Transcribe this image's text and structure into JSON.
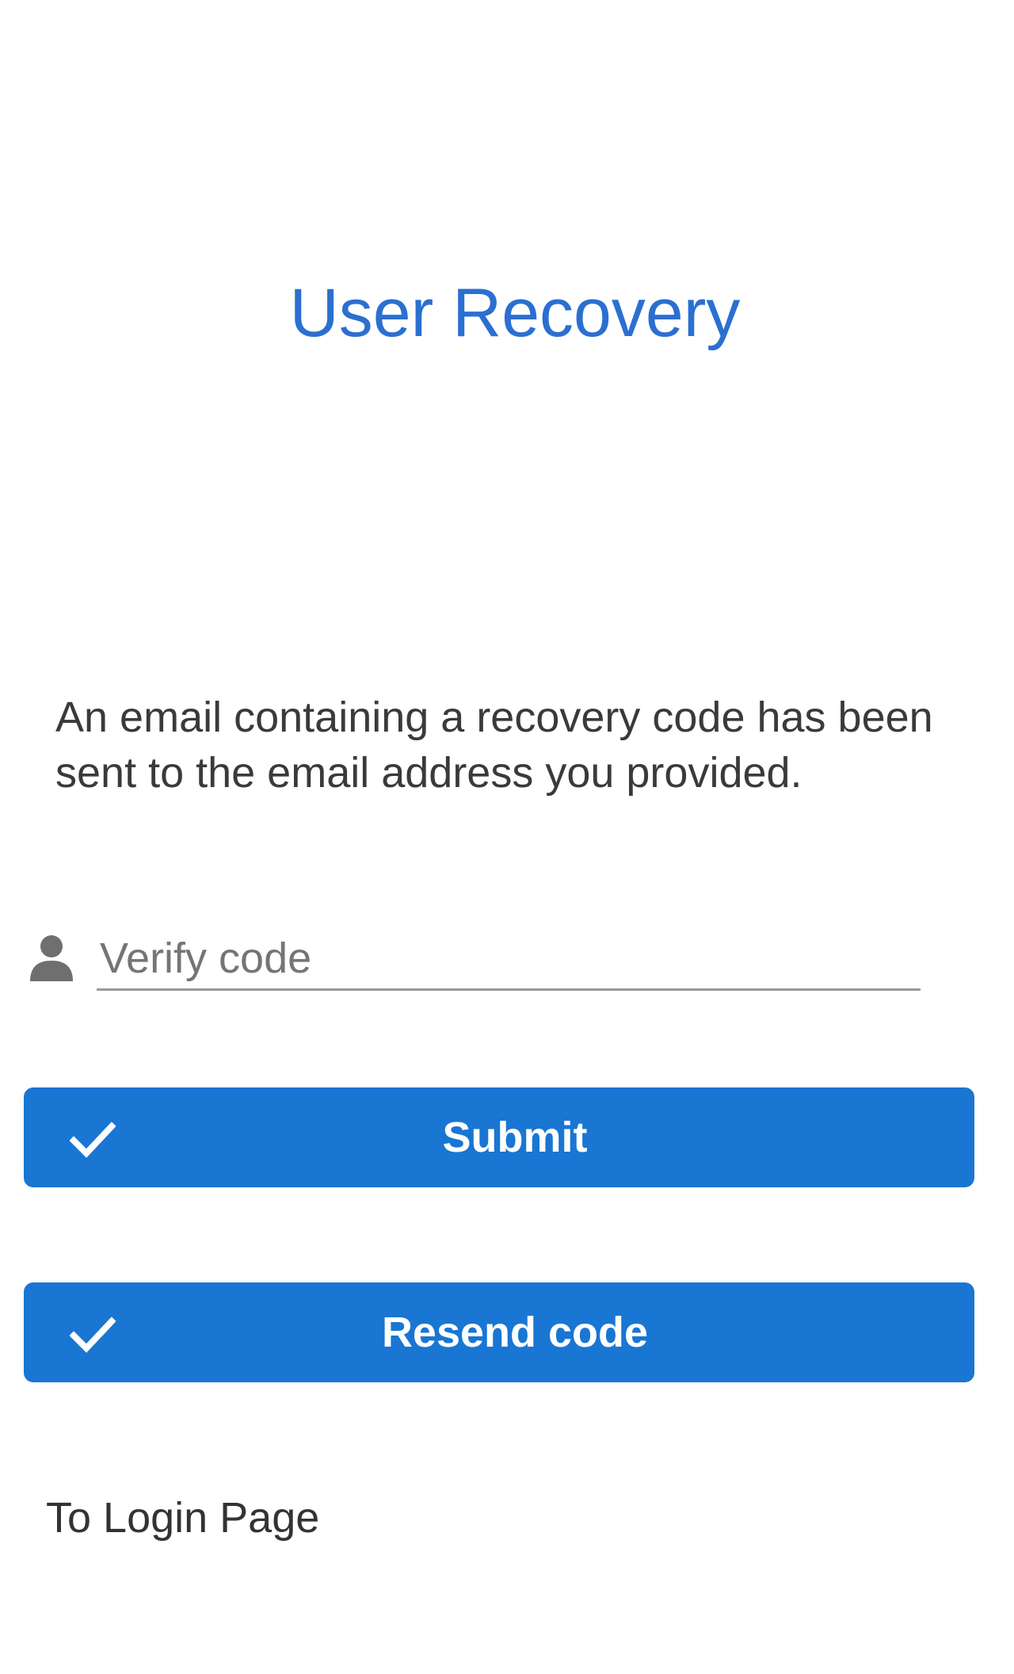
{
  "header": {
    "title": "User Recovery"
  },
  "message": "An email containing a recovery code has been sent to the email address you provided.",
  "form": {
    "code_field": {
      "icon": "user-icon",
      "placeholder": "Verify code",
      "value": ""
    },
    "submit_button": {
      "icon": "check-icon",
      "label": "Submit"
    },
    "resend_button": {
      "icon": "check-icon",
      "label": "Resend code"
    }
  },
  "footer": {
    "login_link": "To Login Page"
  },
  "colors": {
    "title": "#2b6fd1",
    "button_bg": "#1976d2",
    "button_text": "#ffffff",
    "body_text": "#3a3a3a"
  }
}
